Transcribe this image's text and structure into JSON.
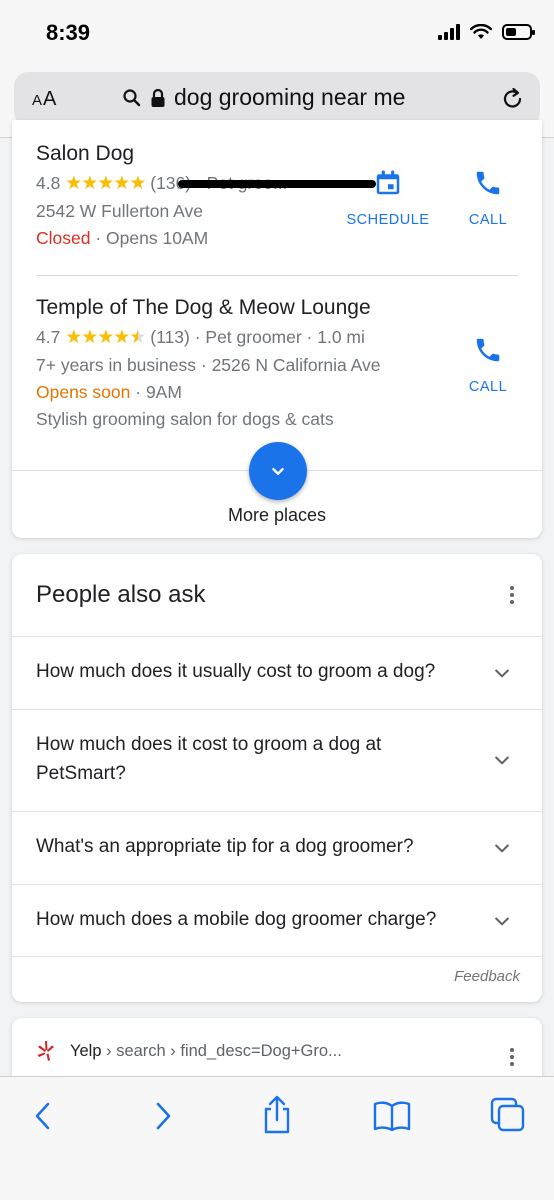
{
  "status": {
    "time": "8:39"
  },
  "browser": {
    "aa_label_big": "A",
    "aa_label_small": "A",
    "aa_label_big2": "A",
    "url": "dog grooming near me"
  },
  "places": [
    {
      "name": "Salon Dog",
      "rating": "4.8",
      "stars": "★★★★★",
      "stars_value": 4.8,
      "reviews": "(136)",
      "type": "· Pet groo...",
      "address": "2542 W Fullerton Ave",
      "status": "Closed",
      "hours": "· Opens 10AM",
      "schedule_label": "SCHEDULE",
      "call_label": "CALL"
    },
    {
      "name": "Temple of The Dog & Meow Lounge",
      "rating": "4.7",
      "stars": "★★★★",
      "half_star": "★",
      "stars_value": 4.7,
      "reviews": "(113)",
      "type": "· Pet groomer · 1.0 mi",
      "details": "7+ years in business · 2526 N California Ave",
      "status": "Opens soon",
      "hours": "· 9AM",
      "description": "Stylish grooming salon for dogs & cats",
      "call_label": "CALL"
    }
  ],
  "more_places_label": "More places",
  "paa": {
    "title": "People also ask",
    "questions": [
      "How much does it usually cost to groom a dog?",
      "How much does it cost to groom a dog at PetSmart?",
      "What's an appropriate tip for a dog groomer?",
      "How much does a mobile dog groomer charge?"
    ],
    "feedback": "Feedback"
  },
  "result": {
    "site": "Yelp",
    "path": "› search › find_desc=Dog+Gro..."
  },
  "colors": {
    "accent_blue": "#1a73e8",
    "star_yellow": "#fbbc04",
    "closed_red": "#d93025",
    "opens_soon_orange": "#e37400",
    "yelp_red": "#d32323"
  },
  "icons": [
    "search-icon",
    "lock-icon",
    "reload-icon",
    "calendar-icon",
    "phone-icon",
    "chevron-down-icon",
    "more-vert-icon",
    "yelp-icon",
    "back-icon",
    "forward-icon",
    "share-icon",
    "bookmarks-icon",
    "tabs-icon"
  ]
}
